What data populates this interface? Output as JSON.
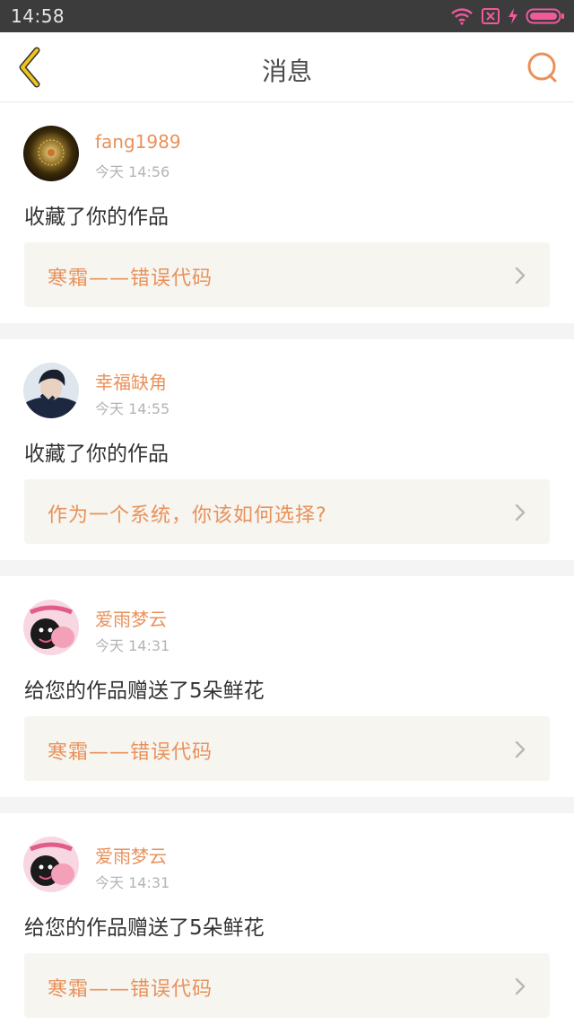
{
  "status_bar": {
    "time": "14:58",
    "icons": [
      "wifi-icon",
      "no-sim-icon",
      "charging-icon",
      "battery-icon"
    ]
  },
  "header": {
    "title": "消息",
    "back_icon": "chevron-left-icon",
    "search_icon": "search-icon"
  },
  "colors": {
    "accent": "#e9915a",
    "back_arrow": "#f0c419",
    "card_link_bg": "#f6f5f0",
    "status_bar_bg": "#3c3c3c"
  },
  "messages": [
    {
      "user": "fang1989",
      "time": "今天 14:56",
      "action": "收藏了你的作品",
      "work": "寒霜——错误代码"
    },
    {
      "user": "幸福缺角",
      "time": "今天 14:55",
      "action": "收藏了你的作品",
      "work": "作为一个系统，你该如何选择?"
    },
    {
      "user": "爱雨梦云",
      "time": "今天 14:31",
      "action": "给您的作品赠送了5朵鲜花",
      "work": "寒霜——错误代码"
    },
    {
      "user": "爱雨梦云",
      "time": "今天 14:31",
      "action": "给您的作品赠送了5朵鲜花",
      "work": "寒霜——错误代码"
    }
  ]
}
